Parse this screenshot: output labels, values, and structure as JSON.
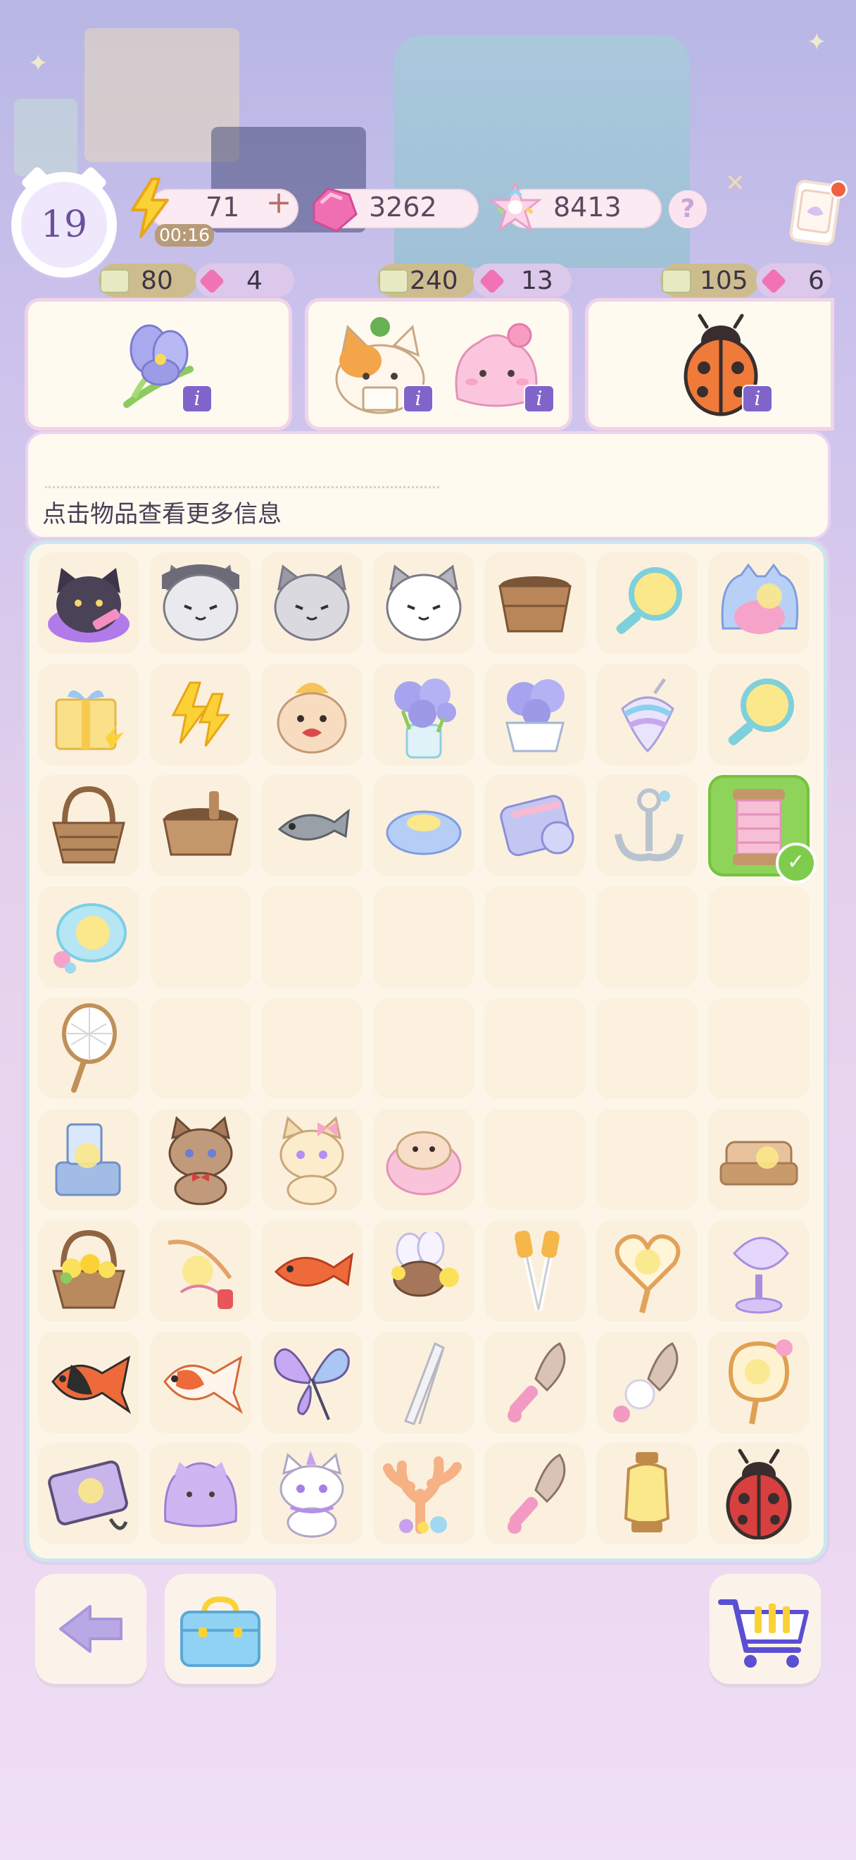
{
  "player": {
    "level": "19"
  },
  "currencies": {
    "energy": {
      "value": "71",
      "timer": "00:16",
      "plus": "+"
    },
    "gems": {
      "value": "3262"
    },
    "stars": {
      "value": "8413"
    },
    "help": "?"
  },
  "orders": [
    {
      "ticket": "80",
      "gems": "4",
      "items": [
        "iris-flower"
      ]
    },
    {
      "ticket": "240",
      "gems": "13",
      "items": [
        "calico-cat-with-letter",
        "pink-jelly-bunny"
      ]
    },
    {
      "ticket": "105",
      "gems": "6",
      "items": [
        "ladybug"
      ]
    }
  ],
  "info_badge": "i",
  "info": {
    "hint": "点击物品查看更多信息"
  },
  "grid": {
    "columns": 7,
    "rows": [
      [
        "purple-guitar-cat",
        "gray-cat-dark",
        "gray-cat-mid",
        "gray-cat-white",
        "wooden-bucket",
        "magnifier-glowing",
        "blue-cat-bed"
      ],
      [
        "gift-box",
        "lightning-bolts",
        "hamster-hat",
        "iris-vase",
        "flower-pot",
        "spinning-top",
        "magnifier-glowing"
      ],
      [
        "wicker-basket",
        "wooden-tub",
        "gray-fish",
        "blue-cushion",
        "yarn-roll",
        "anchor-charm",
        "thread-spool"
      ],
      [
        "sky-dish",
        "",
        "",
        "",
        "",
        "",
        ""
      ],
      [
        "butterfly-net",
        "",
        "",
        "",
        "",
        "",
        ""
      ],
      [
        "blender-machine",
        "brown-cat-bowtie",
        "cream-cat-bow",
        "pink-mochi",
        "",
        "",
        "wooden-sofa"
      ],
      [
        "flower-basket",
        "fishing-rod",
        "goldfish",
        "bee",
        "tongs",
        "heart-net",
        "satellite-dish"
      ],
      [
        "black-goldfish",
        "orange-goldfish",
        "butterfly",
        "tweezers",
        "brush",
        "brush-pompom",
        "flower-net"
      ],
      [
        "camera-bag",
        "purple-jelly",
        "white-unicorn-cat",
        "coral",
        "brush",
        "lantern",
        "ladybug"
      ]
    ],
    "selected": "thread-spool"
  },
  "bottom_bar": {
    "back": "back-arrow",
    "storage": "storage-box",
    "shop": "shopping-cart"
  }
}
